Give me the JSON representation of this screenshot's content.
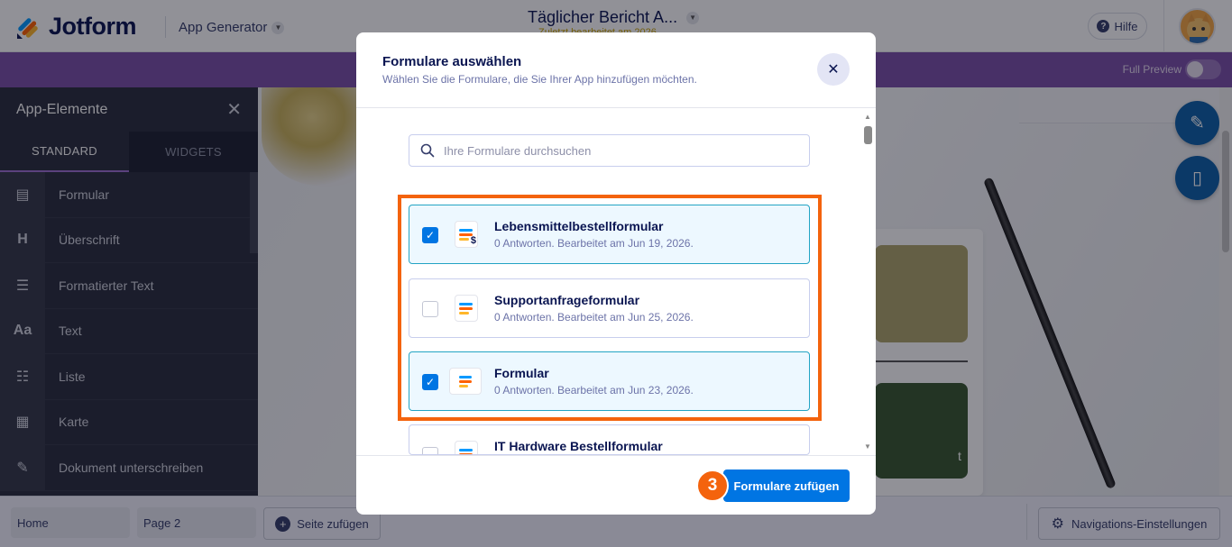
{
  "header": {
    "logo_text": "Jotform",
    "app_generator": "App Generator",
    "app_title": "Täglicher Bericht A...",
    "app_subtitle": "Zuletzt bearbeitet am 2026",
    "help": "Hilfe"
  },
  "purplebar": {
    "full_preview": "Full Preview"
  },
  "sidebar": {
    "title": "App-Elemente",
    "tabs": [
      "STANDARD",
      "WIDGETS"
    ],
    "items": [
      {
        "icon": "form-icon",
        "glyph": "▤",
        "label": "Formular"
      },
      {
        "icon": "heading-icon",
        "glyph": "H",
        "label": "Überschrift"
      },
      {
        "icon": "formatted-text-icon",
        "glyph": "☰",
        "label": "Formatierter Text"
      },
      {
        "icon": "text-icon",
        "glyph": "Aa",
        "label": "Text"
      },
      {
        "icon": "list-icon",
        "glyph": "☷",
        "label": "Liste"
      },
      {
        "icon": "card-icon",
        "glyph": "▦",
        "label": "Karte"
      },
      {
        "icon": "sign-document-icon",
        "glyph": "✎",
        "label": "Dokument unterschreiben"
      }
    ]
  },
  "canvas": {
    "green_card_text": "t"
  },
  "bottombar": {
    "pages": [
      "Home",
      "Page 2"
    ],
    "add_page": "Seite zufügen",
    "nav_settings": "Navigations-Einstellungen"
  },
  "modal": {
    "title": "Formulare auswählen",
    "subtitle": "Wählen Sie die Formulare, die Sie Ihrer App hinzufügen möchten.",
    "search_placeholder": "Ihre Formulare durchsuchen",
    "forms": [
      {
        "name": "Lebensmittelbestellformular",
        "meta": "0 Antworten. Bearbeitet am Jun 19, 2026.",
        "selected": true
      },
      {
        "name": "Supportanfrageformular",
        "meta": "0 Antworten. Bearbeitet am Jun 25, 2026.",
        "selected": false
      },
      {
        "name": "Formular",
        "meta": "0 Antworten. Bearbeitet am Jun 23, 2026.",
        "selected": true
      },
      {
        "name": "IT Hardware Bestellformular",
        "meta": "",
        "selected": false
      }
    ],
    "step_number": "3",
    "add_button": "Formulare zufügen"
  },
  "colors": {
    "brand_navy": "#0a1551",
    "purple_bar": "#7b4fa8",
    "primary_blue": "#0075e3",
    "highlight_orange": "#f4630d"
  }
}
